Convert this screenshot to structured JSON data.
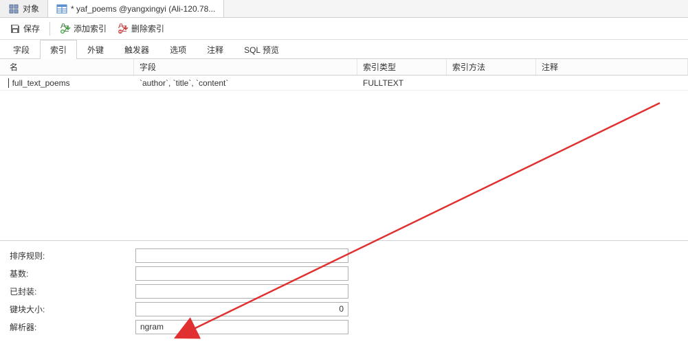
{
  "topTabs": {
    "objects": "对象",
    "editor": "* yaf_poems @yangxingyi (Ali-120.78..."
  },
  "toolbar": {
    "save": "保存",
    "addIndex": "添加索引",
    "deleteIndex": "删除索引"
  },
  "subTabs": {
    "fields": "字段",
    "indexes": "索引",
    "foreignKeys": "外键",
    "triggers": "触发器",
    "options": "选项",
    "comment": "注释",
    "sqlPreview": "SQL 预览"
  },
  "gridHeaders": {
    "name": "名",
    "field": "字段",
    "indexType": "索引类型",
    "indexMethod": "索引方法",
    "comment": "注释"
  },
  "gridRow": {
    "name": "full_text_poems",
    "field": "`author`, `title`, `content`",
    "type": "FULLTEXT",
    "method": "",
    "comment": ""
  },
  "properties": {
    "collation": {
      "label": "排序规则:",
      "value": ""
    },
    "cardinality": {
      "label": "基数:",
      "value": ""
    },
    "packed": {
      "label": "已封装:",
      "value": ""
    },
    "keyBlockSize": {
      "label": "键块大小:",
      "value": "0"
    },
    "parser": {
      "label": "解析器:",
      "value": "ngram"
    }
  }
}
